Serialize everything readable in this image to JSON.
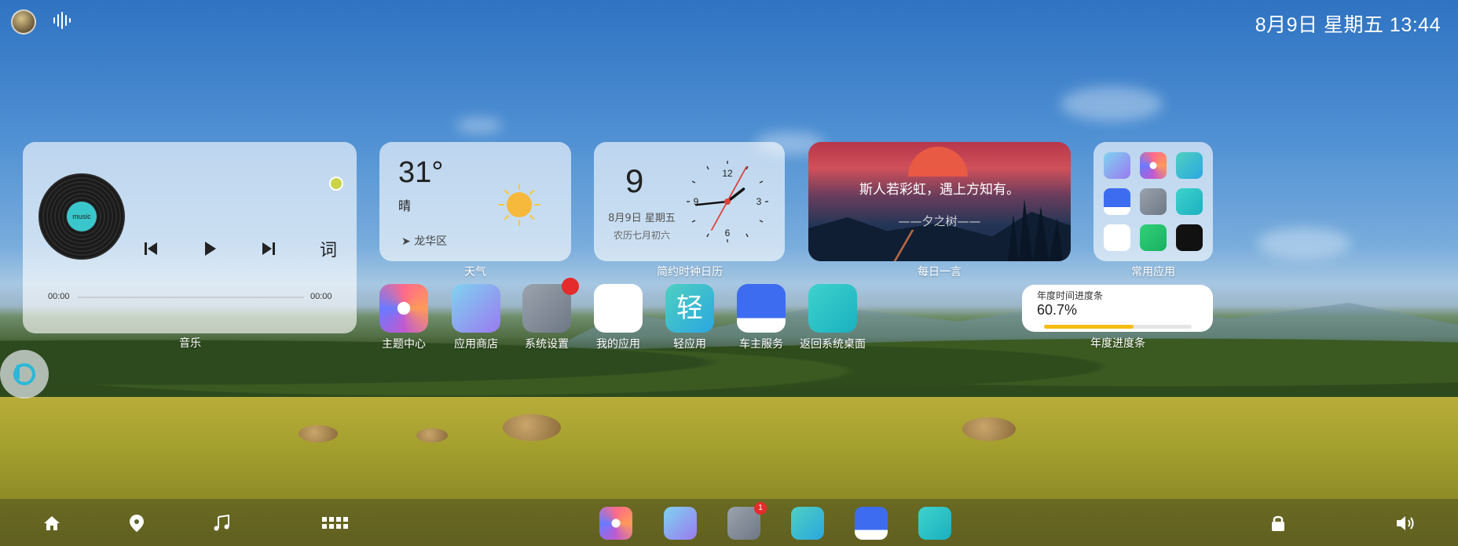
{
  "status_bar": {
    "datetime": "8月9日 星期五 13:44"
  },
  "music_widget": {
    "label": "音乐",
    "disc_text": "music",
    "lyrics_button": "词",
    "time_current": "00:00",
    "time_total": "00:00",
    "progress": 0
  },
  "weather_widget": {
    "label": "天气",
    "temperature": "31°",
    "condition": "晴",
    "location": "龙华区",
    "icon": "sun-icon"
  },
  "clock_widget": {
    "label": "简约时钟日历",
    "day": "9",
    "date_line": "8月9日  星期五",
    "lunar_line": "农历七月初六",
    "dial_numbers": [
      "12",
      "3",
      "6",
      "9"
    ],
    "time": "13:44"
  },
  "quote_widget": {
    "label": "每日一言",
    "text": "斯人若彩虹，遇上方知有。",
    "author": "——夕之树——"
  },
  "common_apps_widget": {
    "label": "常用应用",
    "apps": [
      "store-icon",
      "flower-icon",
      "light-app-icon",
      "car-icon",
      "settings-icon",
      "desktop-icon",
      "my-apps-icon",
      "bluetooth-app-icon",
      "kuwo-icon"
    ]
  },
  "apps": [
    {
      "label": "主题中心",
      "icon": "flower-icon"
    },
    {
      "label": "应用商店",
      "icon": "store-icon"
    },
    {
      "label": "系统设置",
      "icon": "settings-icon",
      "badge": true
    },
    {
      "label": "我的应用",
      "icon": "my-apps-icon"
    },
    {
      "label": "轻应用",
      "icon": "light-app-icon",
      "glyph": "轻"
    },
    {
      "label": "车主服务",
      "icon": "car-icon"
    },
    {
      "label": "返回系统桌面",
      "icon": "desktop-icon"
    }
  ],
  "year_progress": {
    "label": "年度进度条",
    "title": "年度时间进度条",
    "value": "60.7%",
    "fraction": 0.607
  },
  "dock": {
    "left_icons": [
      "home-icon",
      "location-icon",
      "music-note-icon",
      "app-grid-icon"
    ],
    "apps": [
      "flower-icon",
      "store-icon",
      "settings-icon",
      "light-app-icon",
      "car-icon",
      "desktop-icon"
    ],
    "settings_badge": "1",
    "right_icons": [
      "lock-icon",
      "volume-icon"
    ]
  },
  "colors": {
    "accent_yellow": "#f5bd15",
    "badge_red": "#e52b2b"
  }
}
